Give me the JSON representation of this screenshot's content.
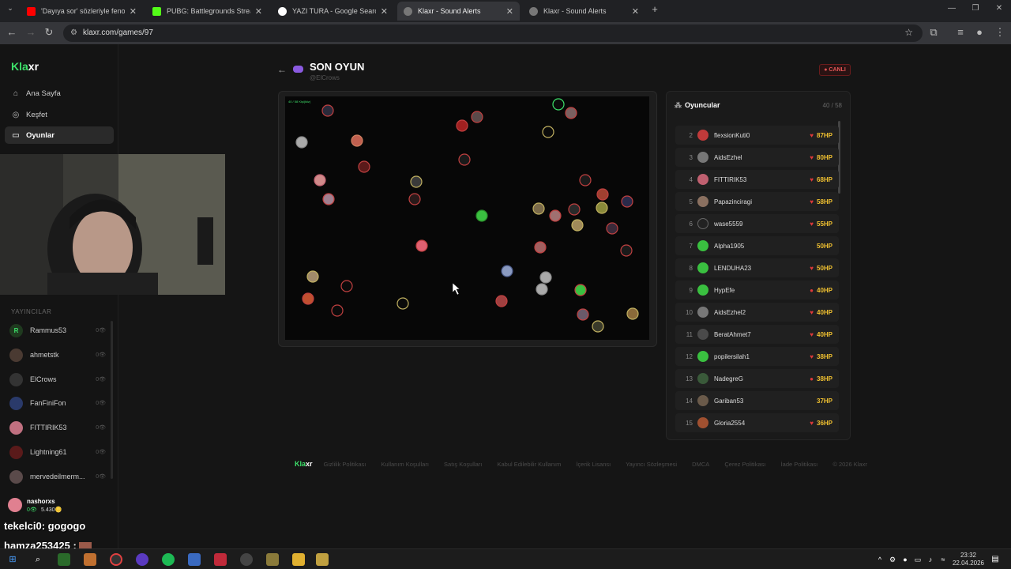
{
  "browser": {
    "tabs": [
      {
        "label": "'Dayıya sor' sözleriyle fenomen",
        "icon": "youtube-icon",
        "color": "#ff0000",
        "active": false
      },
      {
        "label": "PUBG: Battlegrounds Streaming",
        "icon": "kick-icon",
        "color": "#53fc18",
        "active": false
      },
      {
        "label": "YAZI TURA - Google Search",
        "icon": "google-icon",
        "color": "#ffffff",
        "active": false
      },
      {
        "label": "Klaxr - Sound Alerts",
        "icon": "globe-icon",
        "color": "#777777",
        "active": true
      },
      {
        "label": "Klaxr - Sound Alerts",
        "icon": "globe-icon",
        "color": "#777777",
        "active": false
      }
    ],
    "url": "klaxr.com/games/97"
  },
  "sidebar": {
    "logo_a": "Kla",
    "logo_b": "xr",
    "nav": [
      {
        "label": "Ana Sayfa",
        "icon": "home-icon",
        "active": false
      },
      {
        "label": "Keşfet",
        "icon": "compass-icon",
        "active": false
      },
      {
        "label": "Oyunlar",
        "icon": "gamepad-icon",
        "active": true
      }
    ],
    "streamers_title": "YAYINCILAR",
    "streamers": [
      {
        "name": "Rammus53",
        "count": "0👁",
        "avatar_letter": "R",
        "color": "#1f3a1f"
      },
      {
        "name": "ahmetstk",
        "count": "0👁",
        "avatar_letter": "",
        "color": "#4a3a32"
      },
      {
        "name": "ElCrows",
        "count": "0👁",
        "avatar_letter": "",
        "color": "#333333"
      },
      {
        "name": "FanFiniFon",
        "count": "0👁",
        "avatar_letter": "",
        "color": "#2a3a6a"
      },
      {
        "name": "FITTIRIK53",
        "count": "0👁",
        "avatar_letter": "",
        "color": "#c07080"
      },
      {
        "name": "Lightning61",
        "count": "0👁",
        "avatar_letter": "",
        "color": "#5a1a1a"
      },
      {
        "name": "mervedeilmerm...",
        "count": "0👁",
        "avatar_letter": "",
        "color": "#5a4a4a"
      }
    ],
    "user": {
      "name": "nashorxs",
      "views": "0👁",
      "coins": "5.430🪙"
    }
  },
  "chat_overlay": [
    {
      "user": "tekelci0",
      "message": ": gogogo"
    },
    {
      "user": "hamza253425",
      "message": ":"
    }
  ],
  "main": {
    "title": "SON OYUN",
    "subtitle": "@ElCrows",
    "live_badge": "● CANLI",
    "arena_label": "40 / 58 Kişi(ikiz)"
  },
  "players_panel": {
    "title": "Oyuncular",
    "count": "40 / 58",
    "rows": [
      {
        "rank": "2",
        "name": "flexsionKuti0",
        "hp": "87HP",
        "color": "#c03a3a"
      },
      {
        "rank": "3",
        "name": "AidsEzhel",
        "hp": "80HP",
        "color": "#777777"
      },
      {
        "rank": "4",
        "name": "FITTIRIK53",
        "hp": "68HP",
        "color": "#c06070"
      },
      {
        "rank": "5",
        "name": "Papazinciragi",
        "hp": "58HP",
        "color": "#8a7060"
      },
      {
        "rank": "6",
        "name": "wase5559",
        "hp": "55HP",
        "color": "#222222"
      },
      {
        "rank": "7",
        "name": "Alpha1905",
        "hp": "50HP",
        "color": "#3ac040"
      },
      {
        "rank": "8",
        "name": "LENDUHA23",
        "hp": "50HP",
        "color": "#3ac040"
      },
      {
        "rank": "9",
        "name": "HypEfe",
        "hp": "40HP",
        "color": "#3ac040"
      },
      {
        "rank": "10",
        "name": "AidsEzhel2",
        "hp": "40HP",
        "color": "#777777"
      },
      {
        "rank": "11",
        "name": "BeratAhmet7",
        "hp": "40HP",
        "color": "#4a4a4a"
      },
      {
        "rank": "12",
        "name": "popilersilah1",
        "hp": "38HP",
        "color": "#3ac040"
      },
      {
        "rank": "13",
        "name": "NadegreG",
        "hp": "38HP",
        "color": "#3a5a3a"
      },
      {
        "rank": "14",
        "name": "Gariban53",
        "hp": "37HP",
        "color": "#6a5a4a"
      },
      {
        "rank": "15",
        "name": "Gloria2554",
        "hp": "36HP",
        "color": "#a05030"
      }
    ]
  },
  "footer": {
    "logo_a": "Kla",
    "logo_b": "xr",
    "links": [
      "Gizlilik Politikası",
      "Kullanım Koşulları",
      "Satış Koşulları",
      "Kabul Edilebilir Kullanım",
      "İçerik Lisansı",
      "Yayıncı Sözleşmesi",
      "DMCA",
      "Çerez Politikası",
      "İade Politikası",
      "© 2026 Klaxr"
    ]
  },
  "taskbar": {
    "time": "23:32",
    "date": "22.04.2026"
  }
}
